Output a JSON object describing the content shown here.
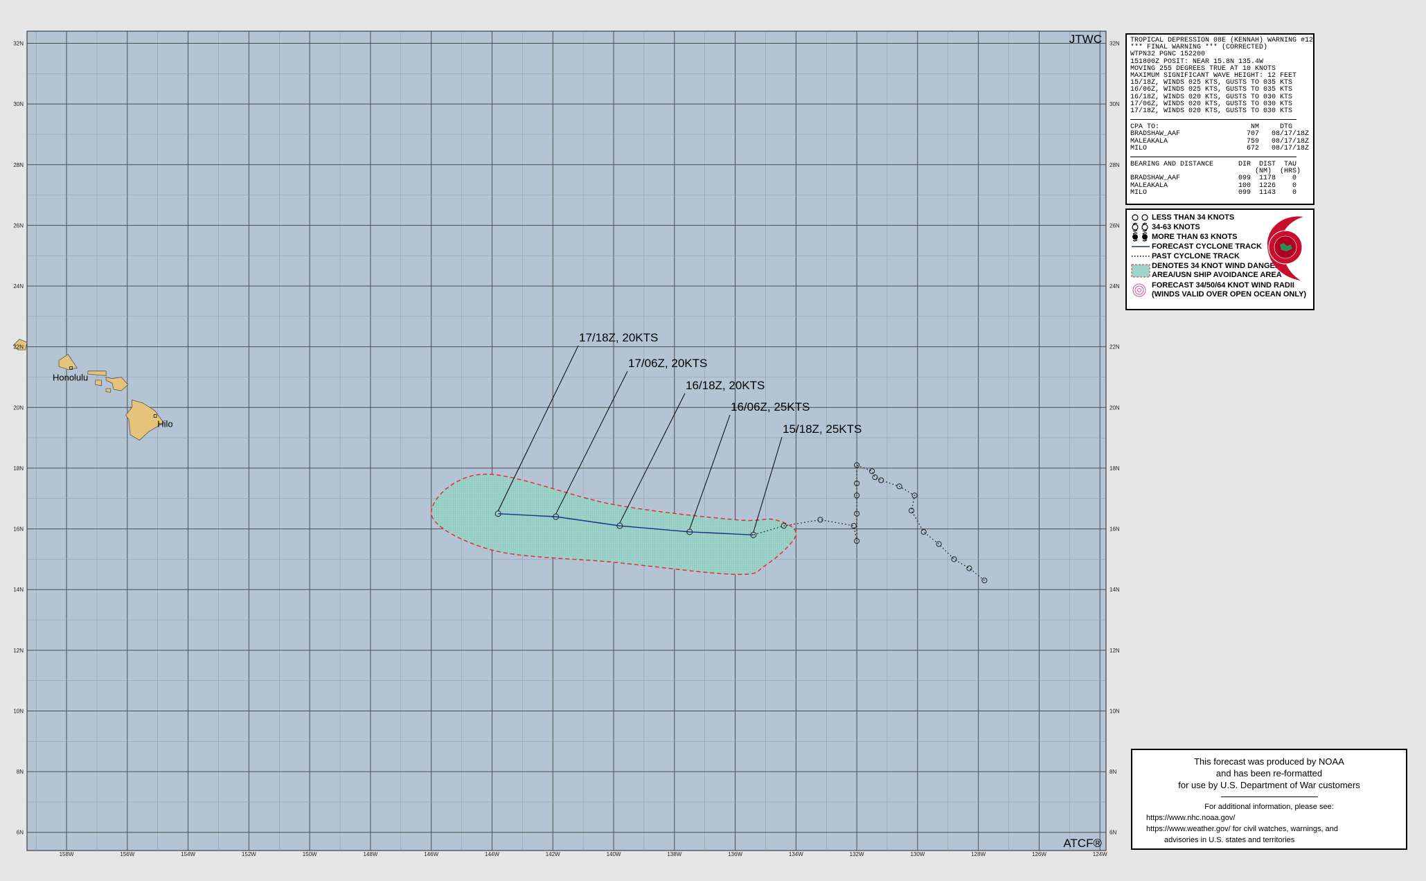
{
  "map": {
    "agency_top": "JTWC",
    "agency_bottom": "ATCF®",
    "lon_labels": [
      "158W",
      "156W",
      "154W",
      "152W",
      "150W",
      "148W",
      "146W",
      "144W",
      "142W",
      "140W",
      "138W",
      "136W",
      "134W",
      "132W",
      "130W",
      "128W",
      "126W",
      "124W"
    ],
    "lat_labels": [
      "6N",
      "8N",
      "10N",
      "12N",
      "14N",
      "16N",
      "18N",
      "20N",
      "22N",
      "24N",
      "26N",
      "28N",
      "30N",
      "32N"
    ],
    "cities": [
      {
        "name": "Honolulu",
        "lat": 21.3,
        "lon": -157.85
      },
      {
        "name": "Hilo",
        "lat": 19.72,
        "lon": -155.08
      }
    ],
    "colors": {
      "ocean": "#b5c4d5",
      "grid": "#4d4d4d",
      "land": "#e6c37a",
      "forecast_track": "#1a2e8c",
      "danger_fill": "#9fd4cc",
      "danger_border": "#e03030"
    }
  },
  "chart_data": {
    "type": "map",
    "forecast_track": [
      {
        "label": "15/18Z,  25KTS",
        "lat": 15.8,
        "lon": -135.4
      },
      {
        "label": "16/06Z,  25KTS",
        "lat": 15.9,
        "lon": -137.5
      },
      {
        "label": "16/18Z,  20KTS",
        "lat": 16.1,
        "lon": -139.8
      },
      {
        "label": "17/06Z,  20KTS",
        "lat": 16.4,
        "lon": -141.9
      },
      {
        "label": "17/18Z,  20KTS",
        "lat": 16.5,
        "lon": -143.8
      }
    ],
    "past_track": [
      {
        "lat": 14.3,
        "lon": -127.8
      },
      {
        "lat": 14.7,
        "lon": -128.3
      },
      {
        "lat": 15.0,
        "lon": -128.8
      },
      {
        "lat": 15.5,
        "lon": -129.3
      },
      {
        "lat": 15.9,
        "lon": -129.8
      },
      {
        "lat": 16.6,
        "lon": -130.2
      },
      {
        "lat": 17.1,
        "lon": -130.1
      },
      {
        "lat": 17.4,
        "lon": -130.6
      },
      {
        "lat": 17.6,
        "lon": -131.2
      },
      {
        "lat": 17.7,
        "lon": -131.4
      },
      {
        "lat": 17.9,
        "lon": -131.5
      },
      {
        "lat": 18.1,
        "lon": -132.0
      },
      {
        "lat": 17.5,
        "lon": -132.0
      },
      {
        "lat": 17.1,
        "lon": -132.0
      },
      {
        "lat": 16.5,
        "lon": -132.0
      },
      {
        "lat": 15.6,
        "lon": -132.0
      },
      {
        "lat": 16.1,
        "lon": -132.1
      },
      {
        "lat": 16.3,
        "lon": -133.2
      },
      {
        "lat": 16.1,
        "lon": -134.4
      }
    ],
    "danger_area": [
      {
        "lat": 17.8,
        "lon": -144.3
      },
      {
        "lat": 16.8,
        "lon": -140.0
      },
      {
        "lat": 16.3,
        "lon": -136.0
      },
      {
        "lat": 16.3,
        "lon": -134.7
      },
      {
        "lat": 15.8,
        "lon": -134.0
      },
      {
        "lat": 14.8,
        "lon": -135.0
      },
      {
        "lat": 14.5,
        "lon": -136.0
      },
      {
        "lat": 14.9,
        "lon": -140.0
      },
      {
        "lat": 15.3,
        "lon": -144.0
      },
      {
        "lat": 16.5,
        "lon": -146.0
      }
    ],
    "lon_range": [
      -159.3,
      -123.8
    ],
    "lat_range": [
      5.4,
      32.4
    ]
  },
  "warning": {
    "lines": [
      "TROPICAL DEPRESSION 08E (KENNAH) WARNING #12",
      "*** FINAL WARNING *** (CORRECTED)",
      "WTPN32 PGNC 152200",
      "151800Z POSIT: NEAR 15.8N 135.4W",
      "MOVING 255 DEGREES TRUE AT 10 KNOTS",
      "MAXIMUM SIGNIFICANT WAVE HEIGHT: 12 FEET",
      "15/18Z, WINDS 025 KTS, GUSTS TO 035 KTS",
      "16/06Z, WINDS 025 KTS, GUSTS TO 035 KTS",
      "16/18Z, WINDS 020 KTS, GUSTS TO 030 KTS",
      "17/06Z, WINDS 020 KTS, GUSTS TO 030 KTS",
      "17/18Z, WINDS 020 KTS, GUSTS TO 030 KTS"
    ],
    "cpa_lines": [
      "CPA TO:                      NM     DTG",
      "BRADSHAW_AAF                707   08/17/18Z",
      "MALEAKALA                   759   08/17/18Z",
      "MILO                        672   08/17/18Z"
    ],
    "bearing_lines": [
      "BEARING AND DISTANCE      DIR  DIST  TAU",
      "                              (NM)  (HRS)",
      "BRADSHAW_AAF              099  1178    0",
      "MALEAKALA                 100  1226    0",
      "MILO                      099  1143    0"
    ]
  },
  "legend": {
    "items": [
      {
        "symbol": "open-circle-icon",
        "text": "LESS THAN 34 KNOTS"
      },
      {
        "symbol": "storm-outline-icon",
        "text": "34-63 KNOTS"
      },
      {
        "symbol": "storm-filled-icon",
        "text": "MORE THAN 63 KNOTS"
      },
      {
        "symbol": "forecast-line-icon",
        "text": "FORECAST CYCLONE TRACK"
      },
      {
        "symbol": "past-dotted-icon",
        "text": "PAST CYCLONE TRACK"
      },
      {
        "symbol": "danger-area-icon",
        "text": "DENOTES 34 KNOT WIND DANGER",
        "text2": "AREA/USN SHIP AVOIDANCE AREA"
      },
      {
        "symbol": "wind-radii-icon",
        "text": "FORECAST 34/50/64 KNOT WIND RADII",
        "text2": "(WINDS VALID OVER OPEN OCEAN ONLY)"
      }
    ]
  },
  "noaa": {
    "line1": "This forecast was produced by NOAA",
    "line2": "and has been re-formatted",
    "line3": "for use by U.S. Department of War customers",
    "info": "For additional information, please see:",
    "link1": "https://www.nhc.noaa.gov/",
    "link2": "https://www.weather.gov/ for civil watches, warnings, and",
    "link3": "advisories in U.S. states and territories"
  }
}
